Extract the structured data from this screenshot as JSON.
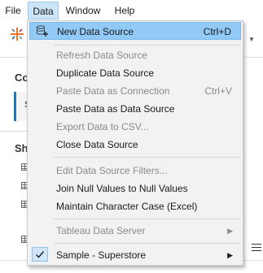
{
  "menubar": {
    "items": [
      {
        "label": "File"
      },
      {
        "label": "Data"
      },
      {
        "label": "Window"
      },
      {
        "label": "Help"
      }
    ]
  },
  "background": {
    "connections_heading": "Co",
    "connection_item_initial": "S",
    "sheets_heading": "Sh"
  },
  "data_menu": {
    "items": [
      {
        "label": "New Data Source",
        "shortcut": "Ctrl+D",
        "enabled": true,
        "highlighted": true,
        "icon": "new-data-source-icon"
      },
      {
        "label": "Refresh Data Source",
        "enabled": false
      },
      {
        "label": "Duplicate Data Source",
        "enabled": true
      },
      {
        "label": "Paste Data as Connection",
        "shortcut": "Ctrl+V",
        "enabled": false
      },
      {
        "label": "Paste Data as Data Source",
        "enabled": true
      },
      {
        "label": "Export Data to CSV...",
        "enabled": false
      },
      {
        "label": "Close Data Source",
        "enabled": true
      },
      {
        "label": "Edit Data Source Filters...",
        "enabled": false
      },
      {
        "label": "Join Null Values to Null Values",
        "enabled": true
      },
      {
        "label": "Maintain Character Case (Excel)",
        "enabled": true
      },
      {
        "label": "Tableau Data Server",
        "enabled": false,
        "submenu": true
      },
      {
        "label": "Sample - Superstore",
        "enabled": true,
        "checked": true,
        "submenu": true
      }
    ]
  },
  "colors": {
    "menu_highlight": "#91c9f7",
    "menubar_active": "#cce4f7",
    "disabled_text": "#8a8a8a",
    "menu_background": "#f2f2f2"
  }
}
